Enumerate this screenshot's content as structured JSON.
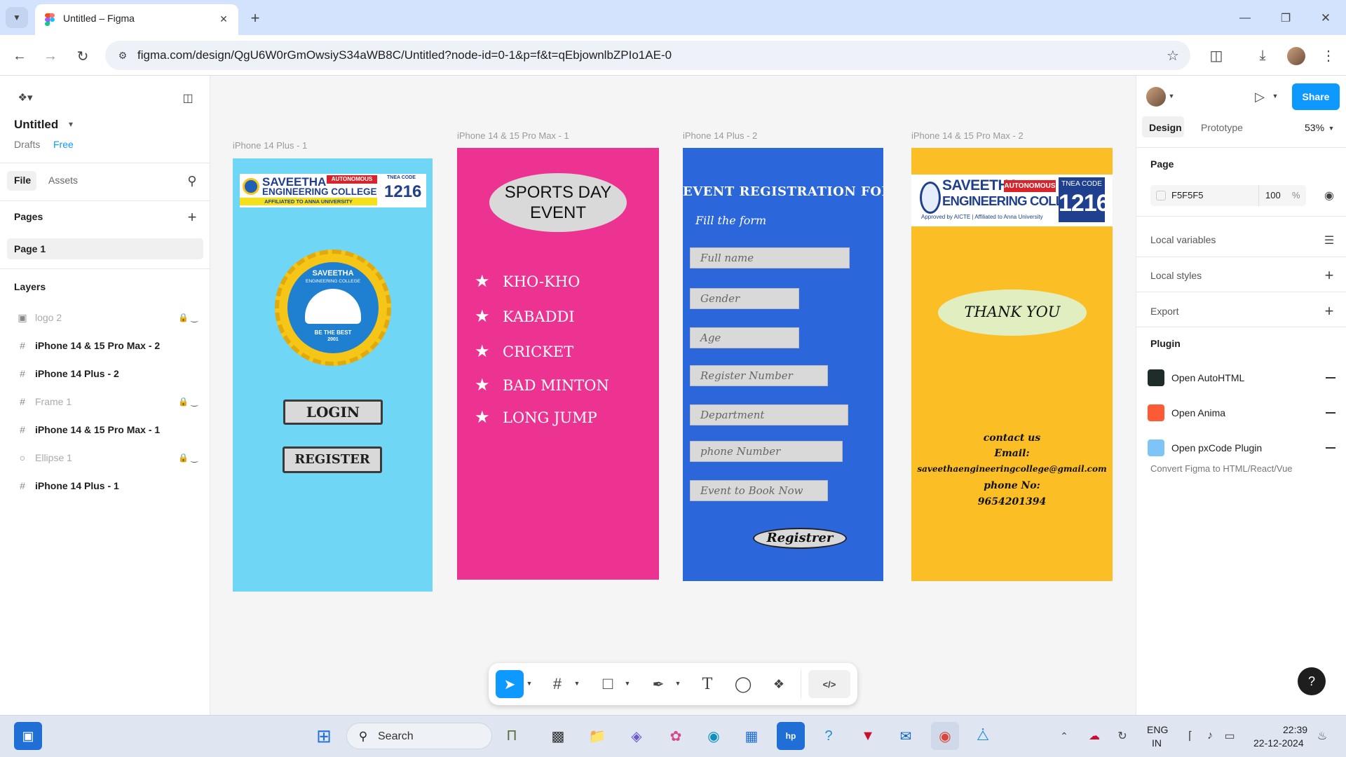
{
  "browser": {
    "tab_title": "Untitled – Figma",
    "url": "figma.com/design/QgU6W0rGmOwsiyS34aWB8C/Untitled?node-id=0-1&p=f&t=qEbjownlbZPIo1AE-0"
  },
  "left_panel": {
    "file_name": "Untitled",
    "drafts": "Drafts",
    "plan": "Free",
    "tab_file": "File",
    "tab_assets": "Assets",
    "pages_heading": "Pages",
    "page_1": "Page 1",
    "layers_heading": "Layers",
    "layers": [
      {
        "name": "logo 2",
        "icon": "image-icon",
        "locked": true,
        "hidden": true
      },
      {
        "name": "iPhone 14 & 15 Pro Max - 2",
        "icon": "frame-icon",
        "locked": false,
        "hidden": false
      },
      {
        "name": "iPhone 14 Plus - 2",
        "icon": "frame-icon",
        "locked": false,
        "hidden": false
      },
      {
        "name": "Frame 1",
        "icon": "frame-icon",
        "locked": true,
        "hidden": true
      },
      {
        "name": "iPhone 14 & 15 Pro Max - 1",
        "icon": "frame-icon",
        "locked": false,
        "hidden": false
      },
      {
        "name": "Ellipse 1",
        "icon": "ellipse-icon",
        "locked": true,
        "hidden": true
      },
      {
        "name": "iPhone 14 Plus - 1",
        "icon": "frame-icon",
        "locked": false,
        "hidden": false
      }
    ]
  },
  "canvas": {
    "background": "#F5F5F5",
    "frame1": {
      "label": "iPhone 14 Plus - 1",
      "bg": "#6FD6F5",
      "college_name": "SAVEETHA",
      "college_sub": "ENGINEERING COLLEGE",
      "autonomous": "AUTONOMOUS",
      "affiliated": "AFFILIATED TO ANNA UNIVERSITY",
      "tnea_label": "TNEA CODE",
      "tnea_code": "1216",
      "emblem_title": "SAVEETHA",
      "emblem_sub": "ENGINEERING COLLEGE",
      "emblem_motto": "BE THE BEST",
      "emblem_year": "2001",
      "login": "LOGIN",
      "register": "REGISTER"
    },
    "frame2": {
      "label": "iPhone 14 & 15 Pro Max - 1",
      "bg": "#EC3391",
      "title_line1": "SPORTS DAY",
      "title_line2": "EVENT",
      "sports": [
        "KHO-KHO",
        "KABADDI",
        "CRICKET",
        "BAD MINTON",
        "LONG JUMP"
      ]
    },
    "frame3": {
      "label": "iPhone 14 Plus - 2",
      "bg": "#2C66DB",
      "title": "EVENT REGISTRATION FORM",
      "subtitle": "Fill the form",
      "fields": [
        "Full name",
        "Gender",
        "Age",
        "Register Number",
        "Department",
        "phone Number",
        "Event to Book Now"
      ],
      "button": "Registrer"
    },
    "frame4": {
      "label": "iPhone 14 & 15 Pro Max - 2",
      "bg": "#FBBF25",
      "college_name": "SAVEETHA",
      "college_sub": "ENGINEERING COLLEGE",
      "autonomous": "AUTONOMOUS",
      "approved": "Approved by AICTE | Affiliated to Anna University",
      "tnea_label": "TNEA CODE",
      "tnea_code": "1216",
      "thanks": "THANK YOU",
      "contact_1": "contact us",
      "contact_2": "Email:",
      "contact_3": "saveethaengineeringcollege@gmail.com",
      "contact_4": "phone No:",
      "contact_5": "9654201394"
    }
  },
  "right_panel": {
    "share": "Share",
    "tab_design": "Design",
    "tab_prototype": "Prototype",
    "zoom": "53%",
    "page_heading": "Page",
    "page_color": "F5F5F5",
    "page_opacity": "100",
    "percent": "%",
    "local_variables": "Local variables",
    "local_styles": "Local styles",
    "export": "Export",
    "plugin_heading": "Plugin",
    "plugins": [
      {
        "name": "Open AutoHTML",
        "color": "#1f2d2a"
      },
      {
        "name": "Open Anima",
        "color": "#ff5a36"
      },
      {
        "name": "Open pxCode Plugin",
        "color": "#7fc4f6"
      }
    ],
    "plugin_desc": "Convert Figma to HTML/React/Vue"
  },
  "taskbar": {
    "search": "Search",
    "lang1": "ENG",
    "lang2": "IN",
    "time": "22:39",
    "date": "22-12-2024"
  }
}
